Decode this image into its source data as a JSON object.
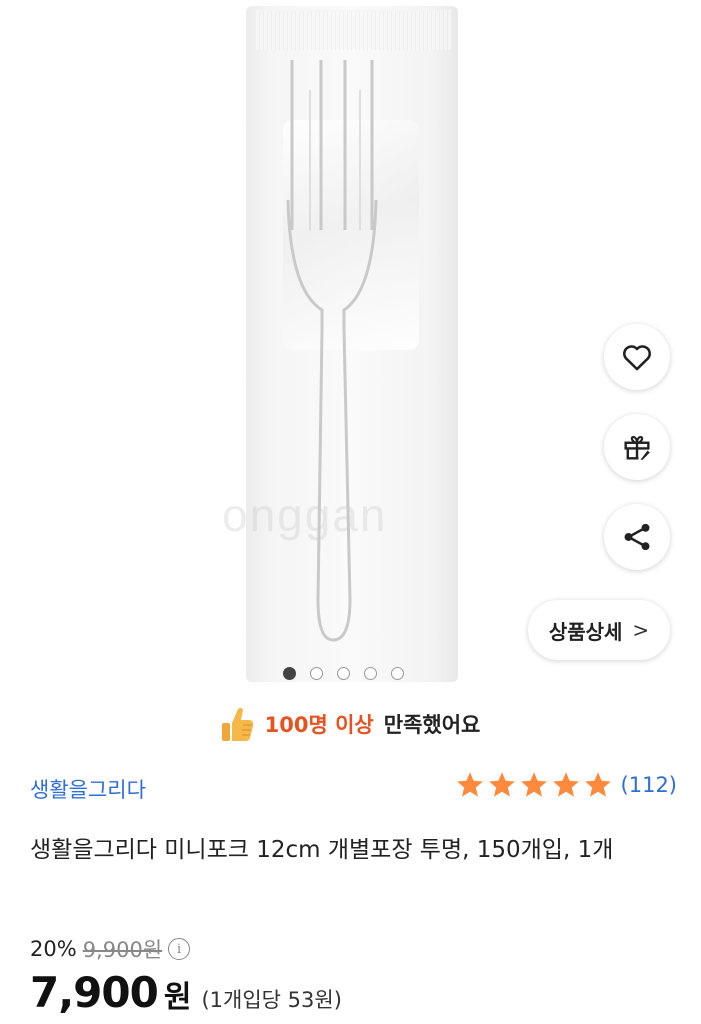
{
  "product_image": {
    "watermark": "onggan",
    "carousel": {
      "total": 5,
      "current": 1
    }
  },
  "actions": {
    "like_icon": "heart-icon",
    "gift_icon": "gift-icon",
    "share_icon": "share-icon",
    "detail_label": "상품상세",
    "detail_chevron": ">"
  },
  "satisfaction": {
    "highlight": "100명 이상",
    "rest": "만족했어요",
    "icon": "thumbs-up-icon"
  },
  "brand": {
    "name": "생활을그리다"
  },
  "rating": {
    "stars": 5,
    "count_label": "(112)",
    "star_color": "#ff8a3d"
  },
  "title": "생활을그리다 미니포크 12cm 개별포장 투명, 150개입, 1개",
  "pricing": {
    "discount": "20%",
    "original_price": "9,900원",
    "info_icon": "info-icon",
    "price": "7,900",
    "currency": "원",
    "unit_price": "(1개입당 53원)"
  },
  "colors": {
    "brand_link": "#2f6ed8",
    "highlight": "#e8521f"
  }
}
